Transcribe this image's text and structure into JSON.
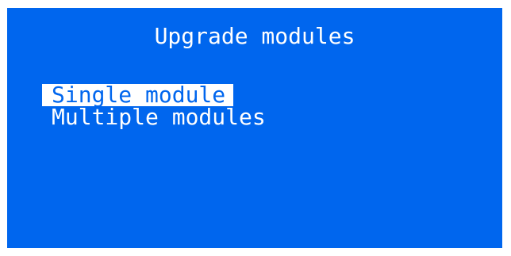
{
  "screen": {
    "title": "Upgrade modules",
    "background_color": "#0066ee",
    "text_color": "#ffffff"
  },
  "menu": {
    "items": [
      {
        "label": "Single module",
        "selected": true
      },
      {
        "label": "Multiple modules",
        "selected": false
      }
    ]
  }
}
